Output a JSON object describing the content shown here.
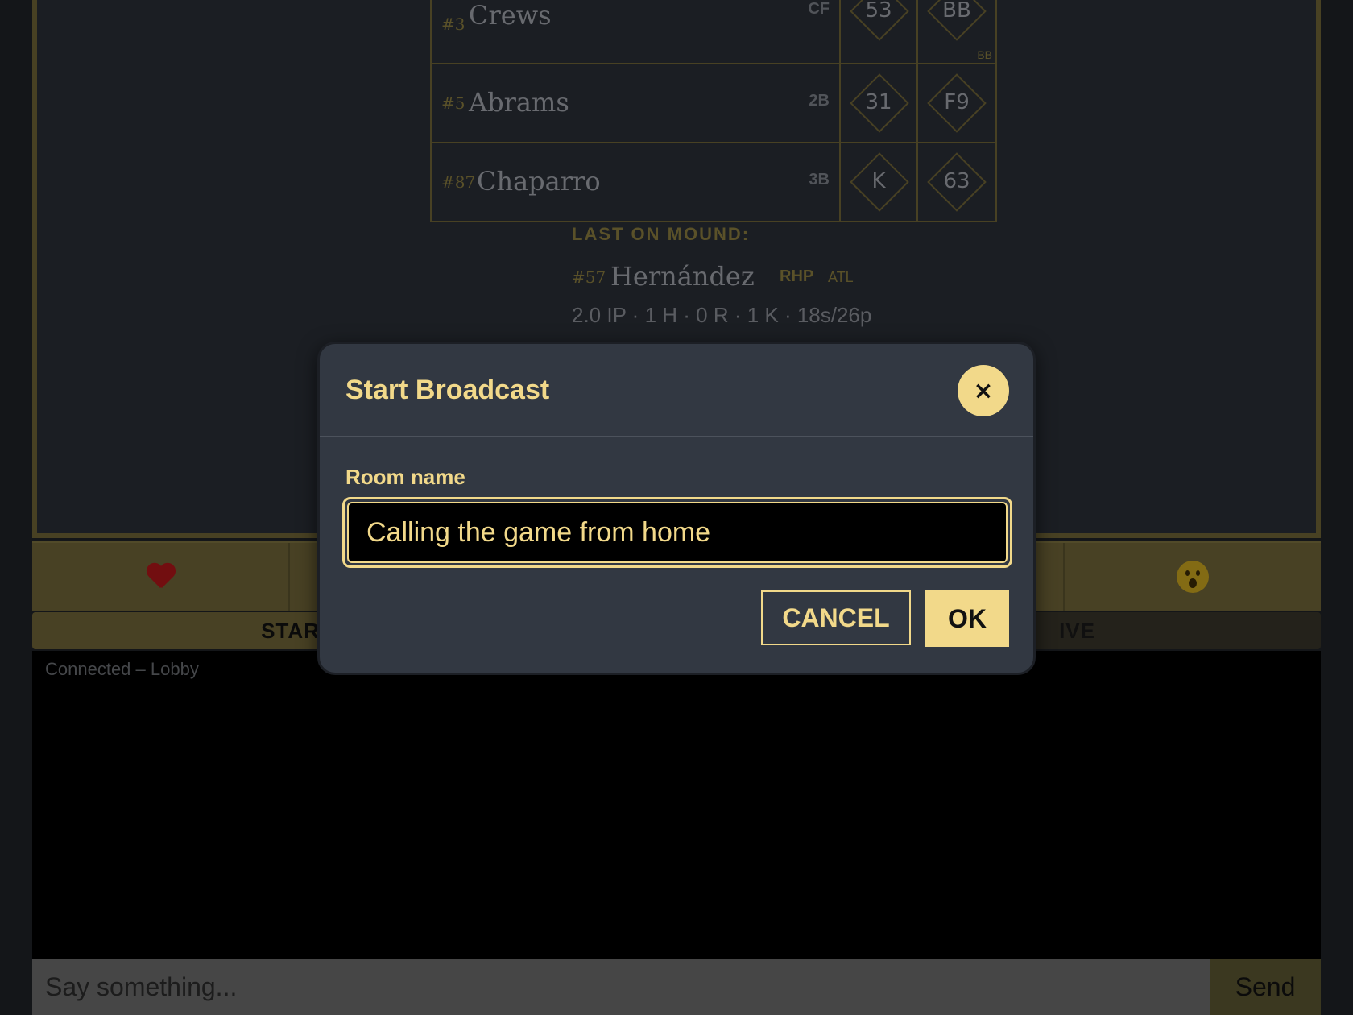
{
  "lineup": [
    {
      "number": "#3",
      "name": "Crews",
      "position": "CF",
      "at_bats": [
        {
          "result": "53",
          "sub": ""
        },
        {
          "result": "BB",
          "sub": "BB"
        }
      ]
    },
    {
      "number": "#5",
      "name": "Abrams",
      "position": "2B",
      "at_bats": [
        {
          "result": "31",
          "sub": ""
        },
        {
          "result": "F9",
          "sub": ""
        }
      ]
    },
    {
      "number": "#87",
      "name": "Chaparro",
      "position": "3B",
      "at_bats": [
        {
          "result": "K",
          "sub": ""
        },
        {
          "result": "63",
          "sub": ""
        }
      ]
    }
  ],
  "mound": {
    "title": "LAST ON MOUND:",
    "number": "#57",
    "name": "Hernández",
    "hand": "RHP",
    "team": "ATL",
    "stats": "2.0 IP · 1 H · 0 R · 1 K · 18s/26p"
  },
  "reactions": [
    {
      "icon": "heart-icon"
    },
    {
      "icon": ""
    },
    {
      "icon": ""
    },
    {
      "icon": ""
    },
    {
      "icon": "surprised-face-icon"
    }
  ],
  "tabs": {
    "start_label": "START",
    "live_label": "IVE"
  },
  "chat": {
    "status": "Connected – Lobby",
    "placeholder": "Say something...",
    "send_label": "Send"
  },
  "modal": {
    "title": "Start Broadcast",
    "close_label": "×",
    "field_label": "Room name",
    "field_value": "Calling the game from home",
    "cancel_label": "CANCEL",
    "ok_label": "OK"
  },
  "colors": {
    "accent": "#f2d98a",
    "scorecard_border": "#6f6536",
    "modal_bg": "#323842"
  }
}
